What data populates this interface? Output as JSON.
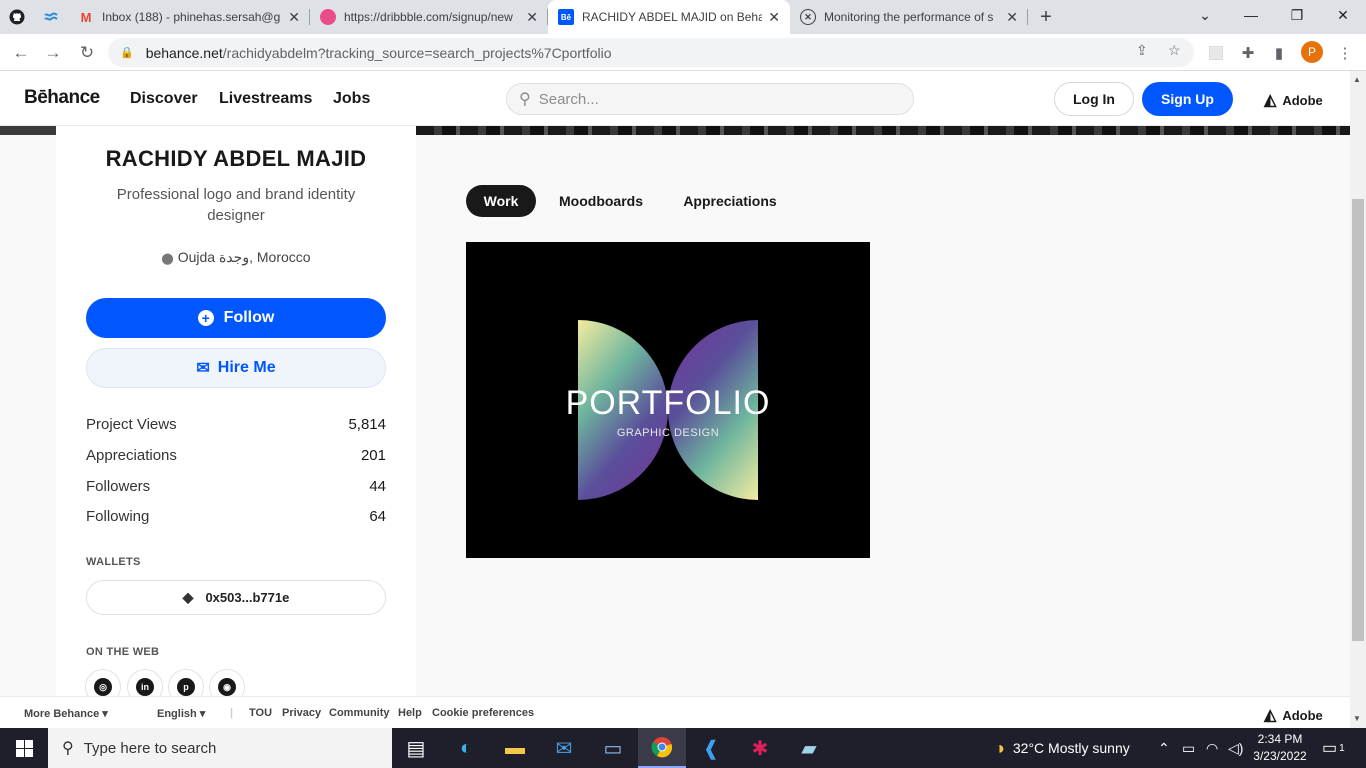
{
  "browser": {
    "tabs": [
      {
        "title": "",
        "icon": "github-icon",
        "pinned": true
      },
      {
        "title": "",
        "icon": "wave-icon",
        "pinned": true
      },
      {
        "title": "Inbox (188) - phinehas.sersah@g",
        "icon": "gmail-icon"
      },
      {
        "title": "https://dribbble.com/signup/new",
        "icon": "dribbble-icon"
      },
      {
        "title": "RACHIDY ABDEL MAJID on Behance",
        "icon": "behance-icon",
        "active": true
      },
      {
        "title": "Monitoring the performance of s",
        "icon": "xbox-icon"
      }
    ],
    "url_host": "behance.net",
    "url_path": "/rachidyabdelm?tracking_source=search_projects%7Cportfolio",
    "profile_initial": "P"
  },
  "header": {
    "logo": "Bēhance",
    "nav": [
      "Discover",
      "Livestreams",
      "Jobs"
    ],
    "search_placeholder": "Search...",
    "login_label": "Log In",
    "signup_label": "Sign Up",
    "adobe_label": "Adobe",
    "accent": "#0057ff"
  },
  "profile": {
    "name": "RACHIDY ABDEL MAJID",
    "tagline": "Professional logo and brand identity designer",
    "location": "Oujda وجدة, Morocco",
    "follow_label": "Follow",
    "hire_label": "Hire Me",
    "stats": [
      {
        "label": "Project Views",
        "value": "5,814"
      },
      {
        "label": "Appreciations",
        "value": "201"
      },
      {
        "label": "Followers",
        "value": "44"
      },
      {
        "label": "Following",
        "value": "64"
      }
    ],
    "wallets_label": "WALLETS",
    "wallet_address": "0x503...b771e",
    "on_the_web_label": "ON THE WEB",
    "social": [
      "dribbble-icon",
      "linkedin-icon",
      "pinterest-icon",
      "instagram-icon"
    ]
  },
  "content": {
    "tabs": [
      {
        "label": "Work",
        "active": true
      },
      {
        "label": "Moodboards",
        "active": false
      },
      {
        "label": "Appreciations",
        "active": false
      }
    ],
    "project": {
      "title": "PORTFOLIO",
      "subtitle": "GRAPHIC DESIGN"
    }
  },
  "footer": {
    "more": "More Behance",
    "language": "English",
    "links": [
      "TOU",
      "Privacy",
      "Community",
      "Help",
      "Cookie preferences"
    ],
    "adobe_label": "Adobe"
  },
  "taskbar": {
    "search_placeholder": "Type here to search",
    "weather": "32°C  Mostly sunny",
    "time": "2:34 PM",
    "date": "3/23/2022",
    "notifications": "1"
  }
}
